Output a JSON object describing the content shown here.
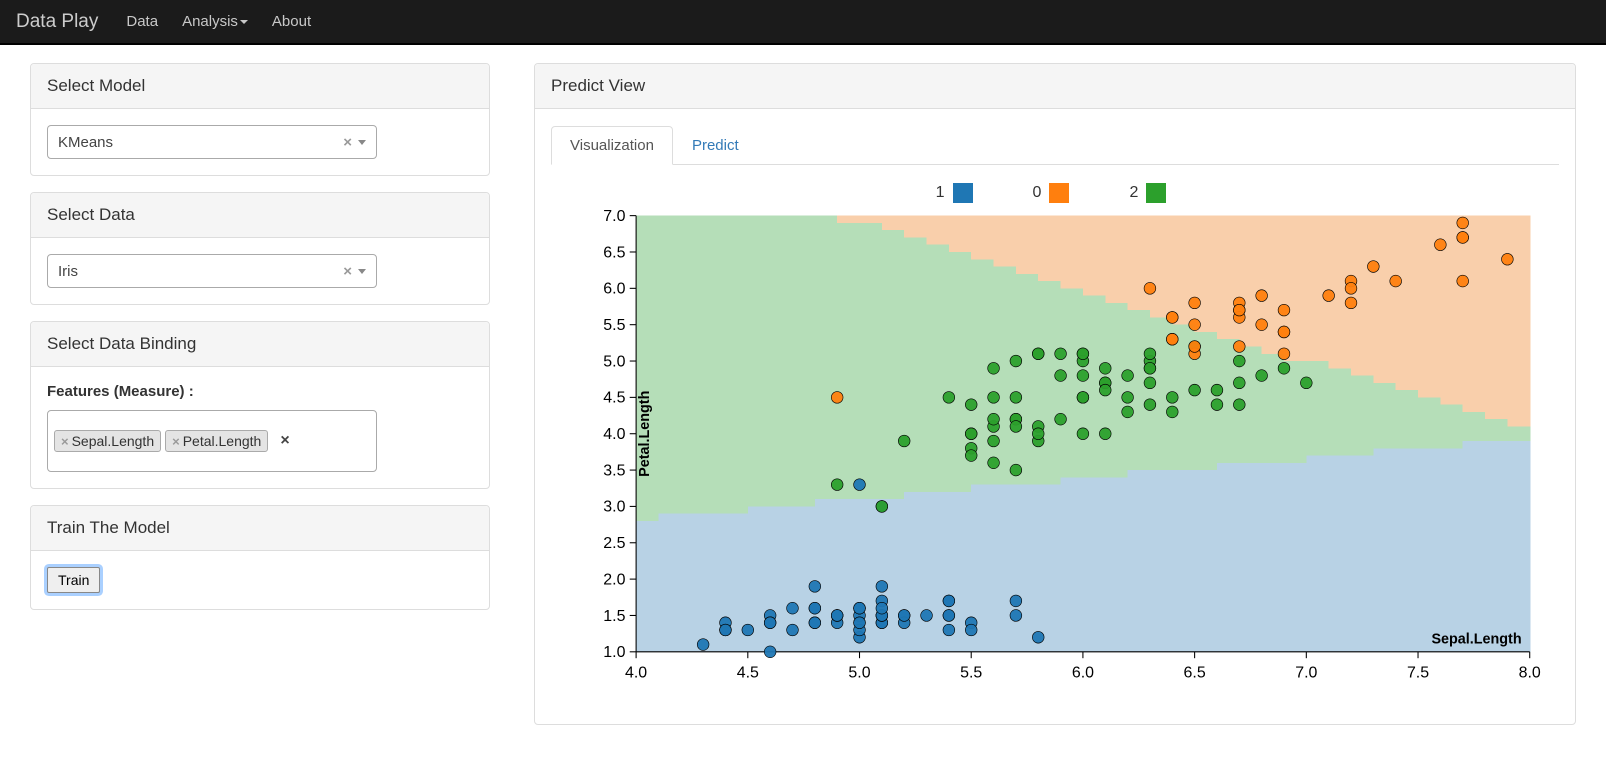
{
  "nav": {
    "brand": "Data Play",
    "items": [
      "Data",
      "Analysis",
      "About"
    ],
    "dropdown_index": 1
  },
  "panels": {
    "select_model": {
      "title": "Select Model",
      "value": "KMeans"
    },
    "select_data": {
      "title": "Select Data",
      "value": "Iris"
    },
    "binding": {
      "title": "Select Data Binding",
      "features_label": "Features (Measure) :",
      "features": [
        "Sepal.Length",
        "Petal.Length"
      ]
    },
    "train": {
      "title": "Train The Model",
      "button": "Train"
    }
  },
  "predict": {
    "title": "Predict View",
    "tabs": [
      "Visualization",
      "Predict"
    ],
    "active_tab": 0
  },
  "chart_data": {
    "type": "scatter",
    "title": "",
    "xlabel": "Sepal.Length",
    "ylabel": "Petal.Length",
    "xlim": [
      4.0,
      8.0
    ],
    "ylim": [
      1.0,
      7.0
    ],
    "xticks": [
      4.0,
      4.5,
      5.0,
      5.5,
      6.0,
      6.5,
      7.0,
      7.5,
      8.0
    ],
    "yticks": [
      1.0,
      1.5,
      2.0,
      2.5,
      3.0,
      3.5,
      4.0,
      4.5,
      5.0,
      5.5,
      6.0,
      6.5,
      7.0
    ],
    "legend": [
      {
        "name": "1",
        "color": "#1f77b4"
      },
      {
        "name": "0",
        "color": "#ff7f0e"
      },
      {
        "name": "2",
        "color": "#2ca02c"
      }
    ],
    "region_colors": {
      "0": "#f9cfab",
      "1": "#b8d2e5",
      "2": "#b5deb8"
    },
    "series": [
      {
        "name": "1",
        "color": "#1f77b4",
        "points": [
          [
            5.1,
            1.4
          ],
          [
            4.9,
            1.4
          ],
          [
            4.7,
            1.3
          ],
          [
            4.6,
            1.5
          ],
          [
            5.0,
            1.4
          ],
          [
            5.4,
            1.7
          ],
          [
            4.6,
            1.4
          ],
          [
            5.0,
            1.5
          ],
          [
            4.4,
            1.4
          ],
          [
            4.9,
            1.5
          ],
          [
            5.4,
            1.5
          ],
          [
            4.8,
            1.6
          ],
          [
            4.8,
            1.4
          ],
          [
            4.3,
            1.1
          ],
          [
            5.8,
            1.2
          ],
          [
            5.7,
            1.5
          ],
          [
            5.4,
            1.3
          ],
          [
            5.1,
            1.4
          ],
          [
            5.7,
            1.7
          ],
          [
            5.1,
            1.5
          ],
          [
            5.4,
            1.7
          ],
          [
            5.1,
            1.5
          ],
          [
            4.6,
            1.0
          ],
          [
            5.1,
            1.7
          ],
          [
            4.8,
            1.9
          ],
          [
            5.0,
            1.6
          ],
          [
            5.0,
            1.6
          ],
          [
            5.2,
            1.5
          ],
          [
            5.2,
            1.4
          ],
          [
            4.7,
            1.6
          ],
          [
            4.8,
            1.6
          ],
          [
            5.4,
            1.5
          ],
          [
            5.2,
            1.5
          ],
          [
            5.5,
            1.4
          ],
          [
            4.9,
            1.5
          ],
          [
            5.0,
            1.2
          ],
          [
            5.5,
            1.3
          ],
          [
            4.9,
            1.5
          ],
          [
            4.4,
            1.3
          ],
          [
            5.1,
            1.5
          ],
          [
            5.0,
            1.3
          ],
          [
            4.5,
            1.3
          ],
          [
            4.4,
            1.3
          ],
          [
            5.0,
            1.6
          ],
          [
            5.1,
            1.9
          ],
          [
            4.8,
            1.4
          ],
          [
            5.1,
            1.6
          ],
          [
            4.6,
            1.4
          ],
          [
            5.3,
            1.5
          ],
          [
            5.0,
            1.4
          ],
          [
            5.0,
            3.3
          ],
          [
            5.1,
            3.0
          ]
        ]
      },
      {
        "name": "2",
        "color": "#2ca02c",
        "points": [
          [
            7.0,
            4.7
          ],
          [
            6.4,
            4.5
          ],
          [
            6.9,
            4.9
          ],
          [
            5.5,
            4.0
          ],
          [
            6.5,
            4.6
          ],
          [
            5.7,
            4.5
          ],
          [
            6.3,
            4.7
          ],
          [
            4.9,
            3.3
          ],
          [
            6.6,
            4.6
          ],
          [
            5.2,
            3.9
          ],
          [
            5.9,
            4.2
          ],
          [
            6.0,
            4.0
          ],
          [
            6.1,
            4.7
          ],
          [
            5.6,
            3.6
          ],
          [
            6.7,
            4.4
          ],
          [
            5.6,
            4.5
          ],
          [
            5.8,
            4.1
          ],
          [
            6.2,
            4.5
          ],
          [
            5.6,
            3.9
          ],
          [
            5.9,
            4.8
          ],
          [
            6.1,
            4.0
          ],
          [
            6.3,
            4.9
          ],
          [
            6.1,
            4.7
          ],
          [
            6.4,
            4.3
          ],
          [
            6.6,
            4.4
          ],
          [
            6.8,
            4.8
          ],
          [
            6.7,
            5.0
          ],
          [
            6.0,
            4.5
          ],
          [
            5.7,
            3.5
          ],
          [
            5.5,
            3.8
          ],
          [
            5.5,
            3.7
          ],
          [
            5.8,
            3.9
          ],
          [
            6.0,
            5.1
          ],
          [
            5.4,
            4.5
          ],
          [
            6.0,
            4.5
          ],
          [
            6.7,
            4.7
          ],
          [
            6.3,
            4.4
          ],
          [
            5.6,
            4.1
          ],
          [
            5.5,
            4.0
          ],
          [
            5.5,
            4.4
          ],
          [
            6.1,
            4.6
          ],
          [
            5.8,
            4.0
          ],
          [
            5.6,
            4.2
          ],
          [
            5.7,
            4.2
          ],
          [
            5.7,
            4.2
          ],
          [
            6.2,
            4.3
          ],
          [
            5.1,
            3.0
          ],
          [
            5.7,
            4.1
          ],
          [
            5.8,
            5.1
          ],
          [
            6.3,
            5.0
          ],
          [
            6.5,
            5.2
          ],
          [
            6.2,
            4.8
          ],
          [
            5.9,
            5.1
          ],
          [
            6.0,
            4.8
          ],
          [
            5.7,
            5.0
          ],
          [
            6.3,
            4.9
          ],
          [
            5.6,
            4.9
          ],
          [
            6.1,
            4.9
          ],
          [
            6.0,
            5.0
          ],
          [
            5.8,
            5.1
          ],
          [
            6.0,
            5.1
          ],
          [
            6.3,
            5.1
          ]
        ]
      },
      {
        "name": "0",
        "color": "#ff7f0e",
        "points": [
          [
            6.3,
            6.0
          ],
          [
            7.1,
            5.9
          ],
          [
            6.5,
            5.8
          ],
          [
            7.6,
            6.6
          ],
          [
            4.9,
            4.5
          ],
          [
            7.3,
            6.3
          ],
          [
            6.7,
            5.8
          ],
          [
            7.2,
            6.1
          ],
          [
            6.5,
            5.1
          ],
          [
            6.4,
            5.3
          ],
          [
            6.8,
            5.5
          ],
          [
            6.4,
            5.6
          ],
          [
            6.5,
            5.5
          ],
          [
            7.7,
            6.7
          ],
          [
            7.7,
            6.9
          ],
          [
            6.9,
            5.7
          ],
          [
            7.7,
            6.7
          ],
          [
            6.7,
            5.7
          ],
          [
            7.2,
            6.0
          ],
          [
            6.4,
            5.3
          ],
          [
            7.2,
            5.8
          ],
          [
            7.4,
            6.1
          ],
          [
            7.9,
            6.4
          ],
          [
            6.4,
            5.6
          ],
          [
            7.7,
            6.1
          ],
          [
            6.9,
            5.4
          ],
          [
            6.7,
            5.6
          ],
          [
            6.9,
            5.1
          ],
          [
            6.8,
            5.9
          ],
          [
            6.7,
            5.7
          ],
          [
            6.7,
            5.2
          ],
          [
            6.5,
            5.2
          ],
          [
            6.9,
            5.4
          ]
        ]
      }
    ]
  }
}
